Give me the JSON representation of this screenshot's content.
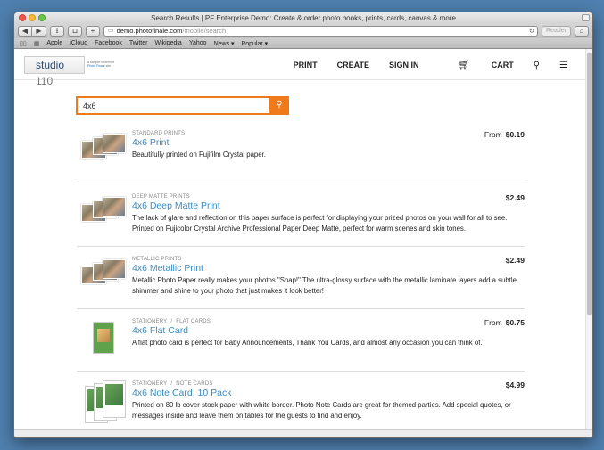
{
  "browser": {
    "window_title": "Search Results | PF Enterprise Demo: Create & order photo books, prints, cards, canvas & more",
    "url_domain": "demo.photofinale.com",
    "url_path": "/mobile/search",
    "reader_label": "Reader",
    "bookmarks": [
      "Apple",
      "iCloud",
      "Facebook",
      "Twitter",
      "Wikipedia",
      "Yahoo",
      "News ▾",
      "Popular ▾"
    ]
  },
  "site": {
    "logo_text": "studio",
    "logo_num": "110",
    "tagline_line1": "a sample storefront",
    "tagline_line2": "Photo Finale",
    "tagline_suffix": "site",
    "nav": {
      "print": "PRINT",
      "create": "CREATE",
      "signin": "SIGN IN",
      "cart": "CART"
    }
  },
  "search": {
    "query": "4x6"
  },
  "results": [
    {
      "category": "STANDARD PRINTS",
      "title": "4x6 Print",
      "description": "Beautifully printed on Fujifilm Crystal paper.",
      "price_prefix": "From",
      "price": "$0.19",
      "thumb": "photo-prints"
    },
    {
      "category": "DEEP MATTE PRINTS",
      "title": "4x6 Deep Matte Print",
      "description": "The lack of glare and reflection on this paper surface is perfect for displaying your prized photos on your wall for all to see. Printed on Fujicolor Crystal Archive Professional Paper Deep Matte, perfect for warm scenes and skin tones.",
      "price_prefix": "",
      "price": "$2.49",
      "thumb": "photo-prints"
    },
    {
      "category": "METALLIC PRINTS",
      "title": "4x6 Metallic Print",
      "description": "Metallic Photo Paper really makes your photos \"Snap!\" The ultra-glossy surface with the metallic laminate layers add a subtle shimmer and shine to your photo that just makes it look better!",
      "price_prefix": "",
      "price": "$2.49",
      "thumb": "photo-prints"
    },
    {
      "category": "STATIONERY",
      "subcategory": "FLAT CARDS",
      "title": "4x6 Flat Card",
      "description": "A flat photo card is perfect for Baby Announcements, Thank You Cards, and almost any occasion you can think of.",
      "price_prefix": "From",
      "price": "$0.75",
      "thumb": "flat-card"
    },
    {
      "category": "STATIONERY",
      "subcategory": "NOTE CARDS",
      "title": "4x6 Note Card, 10 Pack",
      "description": "Printed on 80 lb cover stock paper with white border. Photo Note Cards are great for themed parties. Add special quotes, or messages inside and leave them on tables for the guests to find and enjoy.",
      "price_prefix": "",
      "price": "$4.99",
      "thumb": "note-cards"
    }
  ]
}
